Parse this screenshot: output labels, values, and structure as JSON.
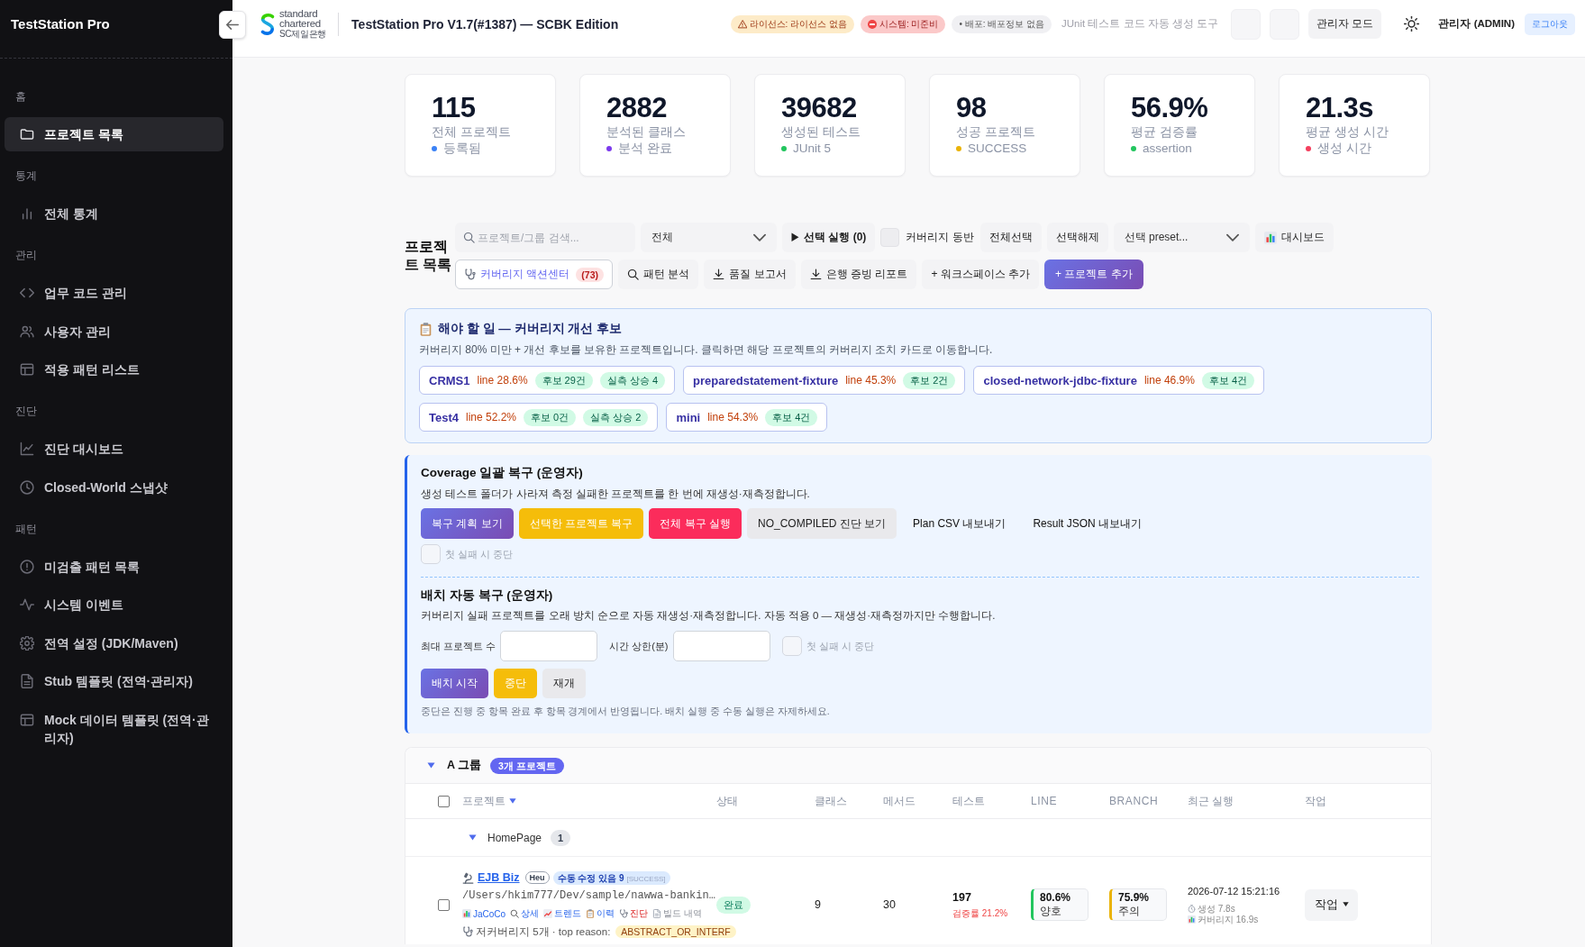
{
  "sidebar": {
    "title": "TestStation Pro",
    "sections": [
      {
        "heading": "홈",
        "items": [
          {
            "label": "프로젝트 목록",
            "selected": true
          }
        ]
      },
      {
        "heading": "통계",
        "items": [
          {
            "label": "전체 통계",
            "selected": false
          }
        ]
      },
      {
        "heading": "관리",
        "items": [
          {
            "label": "업무 코드 관리",
            "selected": false
          },
          {
            "label": "사용자 관리",
            "selected": false
          },
          {
            "label": "적용 패턴 리스트",
            "selected": false
          }
        ]
      },
      {
        "heading": "진단",
        "items": [
          {
            "label": "진단 대시보드",
            "selected": false
          },
          {
            "label": "Closed-World 스냅샷",
            "selected": false
          }
        ]
      },
      {
        "heading": "패턴",
        "items": [
          {
            "label": "미검출 패턴 목록",
            "selected": false
          },
          {
            "label": "시스템 이벤트",
            "selected": false
          },
          {
            "label": "전역 설정 (JDK/Maven)",
            "selected": false
          },
          {
            "label": "Stub 템플릿 (전역·관리자)",
            "selected": false
          },
          {
            "label": "Mock 데이터 템플릿 (전역·관리자)",
            "selected": false
          }
        ]
      }
    ]
  },
  "header": {
    "logo": [
      "standard",
      "chartered",
      "SC제일은행"
    ],
    "title": "TestStation Pro V1.7(#1387) — SCBK Edition",
    "badges": [
      {
        "text": "라이선스: 라이선스 없음",
        "kind": "warning"
      },
      {
        "text": "시스템: 미준비",
        "kind": "danger"
      },
      {
        "text": "• 배포: 배포정보 없음",
        "kind": "neutral"
      }
    ],
    "tagline": "JUnit 테스트 코드 자동 생성 도구",
    "admin_mode": "관리자 모드",
    "user": "관리자 (ADMIN)",
    "logout": "로그아웃"
  },
  "stats": [
    {
      "value": "115",
      "label": "전체 프로젝트",
      "note": "등록됨",
      "color": "#3b82f6"
    },
    {
      "value": "2882",
      "label": "분석된 클래스",
      "note": "분석 완료",
      "color": "#7c3aed"
    },
    {
      "value": "39682",
      "label": "생성된 테스트",
      "note": "JUnit 5",
      "color": "#22c55e"
    },
    {
      "value": "98",
      "label": "성공 프로젝트",
      "note": "SUCCESS",
      "color": "#eab308"
    },
    {
      "value": "56.9%",
      "label": "평균 검증률",
      "note": "assertion",
      "color": "#22c55e"
    },
    {
      "value": "21.3s",
      "label": "평균 생성 시간",
      "note": "생성 시간",
      "color": "#f43f5e"
    }
  ],
  "project_list": {
    "title": "프로젝트 목록",
    "search": {
      "placeholder": "프로젝트/그룹 검색..."
    },
    "filter": {
      "value": "전체"
    },
    "run_selected": "선택 실행 (0)",
    "with_coverage": {
      "label": "커버리지 동반",
      "checked": false
    },
    "select_all": "전체선택",
    "deselect_all": "선택해제",
    "preset": {
      "value": "선택 preset..."
    },
    "dashboard": "대시보드",
    "actions": [
      {
        "label": "커버리지 액션센터",
        "count": "(73)",
        "kind": "outline"
      },
      {
        "label": "패턴 분석",
        "kind": "default"
      },
      {
        "label": "품질 보고서",
        "kind": "default"
      },
      {
        "label": "은행 증빙 리포트",
        "kind": "default"
      },
      {
        "label": "+ 워크스페이스 추가",
        "kind": "default"
      },
      {
        "label": "+ 프로젝트 추가",
        "kind": "primary"
      }
    ]
  },
  "todo": {
    "title": "해야 할 일 — 커버리지 개선 후보",
    "description": "커버리지 80% 미만 + 개선 후보를 보유한 프로젝트입니다. 클릭하면 해당 프로젝트의 커버리지 조치 카드로 이동합니다.",
    "candidates": [
      {
        "name": "CRMS1",
        "line": "line 28.6%",
        "tags": [
          "후보 29건",
          "실측 상승 4"
        ]
      },
      {
        "name": "preparedstatement-fixture",
        "line": "line 45.3%",
        "tags": [
          "후보 2건"
        ]
      },
      {
        "name": "closed-network-jdbc-fixture",
        "line": "line 46.9%",
        "tags": [
          "후보 4건"
        ]
      },
      {
        "name": "Test4",
        "line": "line 52.2%",
        "tags": [
          "후보 0건",
          "실측 상승 2"
        ]
      },
      {
        "name": "mini",
        "line": "line 54.3%",
        "tags": [
          "후보 4건"
        ]
      }
    ]
  },
  "bulk_recovery": {
    "title": "Coverage 일괄 복구 (운영자)",
    "description": "생성 테스트 폴더가 사라져 측정 실패한 프로젝트를 한 번에 재생성·재측정합니다.",
    "buttons": [
      {
        "label": "복구 계획 보기",
        "kind": "primary"
      },
      {
        "label": "선택한 프로젝트 복구",
        "kind": "warning"
      },
      {
        "label": "전체 복구 실행",
        "kind": "danger"
      },
      {
        "label": "NO_COMPILED 진단 보기",
        "kind": "secondary"
      },
      {
        "label": "Plan CSV 내보내기",
        "kind": "plain"
      },
      {
        "label": "Result JSON 내보내기",
        "kind": "plain"
      }
    ],
    "stop_on_failure": {
      "label": "첫 실패 시 중단",
      "checked": false
    }
  },
  "batch_recovery": {
    "title": "배치 자동 복구 (운영자)",
    "description": "커버리지 실패 프로젝트를 오래 방치 순으로 자동 재생성·재측정합니다. 자동 적용 0 — 재생성·재측정까지만 수행합니다.",
    "max_projects": {
      "label": "최대 프로젝트 수"
    },
    "time_limit": {
      "label": "시간 상한(분)"
    },
    "stop_on_failure": {
      "label": "첫 실패 시 중단",
      "checked": false
    },
    "buttons": [
      {
        "label": "배치 시작",
        "kind": "primary"
      },
      {
        "label": "중단",
        "kind": "warning"
      },
      {
        "label": "재개",
        "kind": "secondary"
      }
    ],
    "note": "중단은 진행 중 항목 완료 후 항목 경계에서 반영됩니다. 배치 실행 중 수동 실행은 자제하세요."
  },
  "groups": [
    {
      "name": "A 그룹",
      "count": "3개 프로젝트",
      "expanded": true,
      "all_selected": false,
      "columns": [
        {
          "label": "프로젝트",
          "sorted": true
        },
        {
          "label": "상태",
          "sorted": false
        },
        {
          "label": "클래스",
          "sorted": false
        },
        {
          "label": "메서드",
          "sorted": false
        },
        {
          "label": "테스트",
          "sorted": false
        },
        {
          "label": "LINE",
          "sorted": false
        },
        {
          "label": "BRANCH",
          "sorted": false
        },
        {
          "label": "최근 실행",
          "sorted": false
        },
        {
          "label": "작업",
          "sorted": false
        }
      ],
      "subgroups": [
        {
          "name": "HomePage",
          "count": "1",
          "expanded": true,
          "projects": [
            {
              "selected": false,
              "name": "EJB Biz",
              "tags": [
                "Heu"
              ],
              "manual_fix": {
                "label": "수동 수정 있음 9",
                "status": "[SUCCESS]"
              },
              "path": "/Users/hkim777/Dev/sample/nawwa-bankin…",
              "links": [
                {
                  "label": "JaCoCo",
                  "kind": "link"
                },
                {
                  "label": "상세",
                  "kind": "link"
                },
                {
                  "label": "트렌드",
                  "kind": "link"
                },
                {
                  "label": "이력",
                  "kind": "link"
                },
                {
                  "label": "진단",
                  "kind": "alert"
                },
                {
                  "label": "빌드 내역",
                  "kind": "muted"
                }
              ],
              "low_coverage": "저커버리지 5개 · top reason:",
              "top_reason": "ABSTRACT_OR_INTERF",
              "status": "완료",
              "classes": "9",
              "methods": "30",
              "tests": "197",
              "verify_rate": "검증률 21.2%",
              "coverage": [
                {
                  "value": "80.6%",
                  "grade": "양호",
                  "kind": "good"
                },
                {
                  "value": "75.9%",
                  "grade": "주의",
                  "kind": "warning"
                }
              ],
              "last_run": "2026-07-12 15:21:16",
              "generation_time": "생성 7.8s",
              "coverage_time": "커버리지 16.9s",
              "action": "작업"
            }
          ]
        }
      ]
    }
  ]
}
